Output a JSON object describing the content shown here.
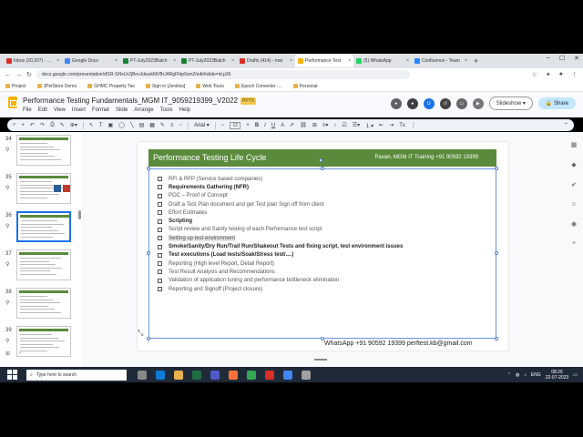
{
  "browser": {
    "tabs": [
      {
        "label": "Inbox (20,207) - ...",
        "color": "#d93025",
        "active": false
      },
      {
        "label": "Google Docs",
        "color": "#4285f4",
        "active": false
      },
      {
        "label": "PT-July2023Batch",
        "color": "#188038",
        "active": false
      },
      {
        "label": "PT-July2023Batch",
        "color": "#188038",
        "active": false
      },
      {
        "label": "Drafts (414) - mai",
        "color": "#d93025",
        "active": false
      },
      {
        "label": "Performance Test",
        "color": "#f4b400",
        "active": true
      },
      {
        "label": "(5) WhatsApp",
        "color": "#25d366",
        "active": false
      },
      {
        "label": "Confluence - Team",
        "color": "#2684ff",
        "active": false
      }
    ],
    "url": "docs.google.com/presentation/d/1R-SHxLh2jBnvJdwuk6tVBrJ4RgFhtp0sm2/edit#slide=id.p36",
    "bookmarks": [
      "Project",
      "JPetStore Demo",
      "GHMC Property Tax",
      "Sign in [Jenkins]",
      "Web Tours",
      "Epoch Converter -...",
      "Personal"
    ]
  },
  "docs": {
    "title": "Performance Testing Fundamentals_MGM IT_9059219399_V2022",
    "badge": "PPTX",
    "menus": [
      "File",
      "Edit",
      "View",
      "Insert",
      "Format",
      "Slide",
      "Arrange",
      "Tools",
      "Help"
    ],
    "slideshow": "Slideshow",
    "share": "Share",
    "font": "Arial",
    "font_size": "12"
  },
  "filmstrip": {
    "slides": [
      {
        "num": "34",
        "selected": false
      },
      {
        "num": "35",
        "selected": false
      },
      {
        "num": "36",
        "selected": true
      },
      {
        "num": "37",
        "selected": false
      },
      {
        "num": "38",
        "selected": false
      },
      {
        "num": "39",
        "selected": false
      }
    ]
  },
  "slide": {
    "title": "Performance Testing Life Cycle",
    "trainer": "Pavan, MGM IT Training +91 90592 19399",
    "items": [
      {
        "text": "RFI & RFP (Service based companies)",
        "bold": false,
        "highlight": false
      },
      {
        "text": "Requirements Gathering (NFR)",
        "bold": true,
        "highlight": false
      },
      {
        "text": "POC – Proof of Concept",
        "bold": false,
        "highlight": false
      },
      {
        "text": "Draft a Test Plan document and get Test plan Sign off from client",
        "bold": false,
        "highlight": false
      },
      {
        "text": "Effort Estimates",
        "bold": false,
        "highlight": false
      },
      {
        "text": "Scripting",
        "bold": true,
        "highlight": false
      },
      {
        "text": "Script review and Sanity testing of each Performance test script",
        "bold": false,
        "highlight": false
      },
      {
        "text": "Setting up test environment",
        "bold": false,
        "highlight": true
      },
      {
        "text": "Smoke/Sanity/Dry Run/Trail Run/Shakeout Tests and fixing script, test environment issues",
        "bold": true,
        "highlight": false
      },
      {
        "text": "Test executions (Load tests/Soak/Stress test/....)",
        "bold": true,
        "highlight": false
      },
      {
        "text": "Reporting (High level Report, Detail Report)",
        "bold": false,
        "highlight": false
      },
      {
        "text": "Test Result Analysis and Recommendations",
        "bold": false,
        "highlight": false
      },
      {
        "text": "Validation of application tuning and performance bottleneck elimination",
        "bold": false,
        "highlight": false
      },
      {
        "text": "Reporting and Signoff (Project closure)",
        "bold": false,
        "highlight": false
      }
    ],
    "footer": "WhatsApp +91 90592 19399 perftest.kb@gmail.com"
  },
  "taskbar": {
    "search_placeholder": "Type here to search",
    "lang": "ENG",
    "time": "08:25",
    "date": "22-07-2023"
  }
}
